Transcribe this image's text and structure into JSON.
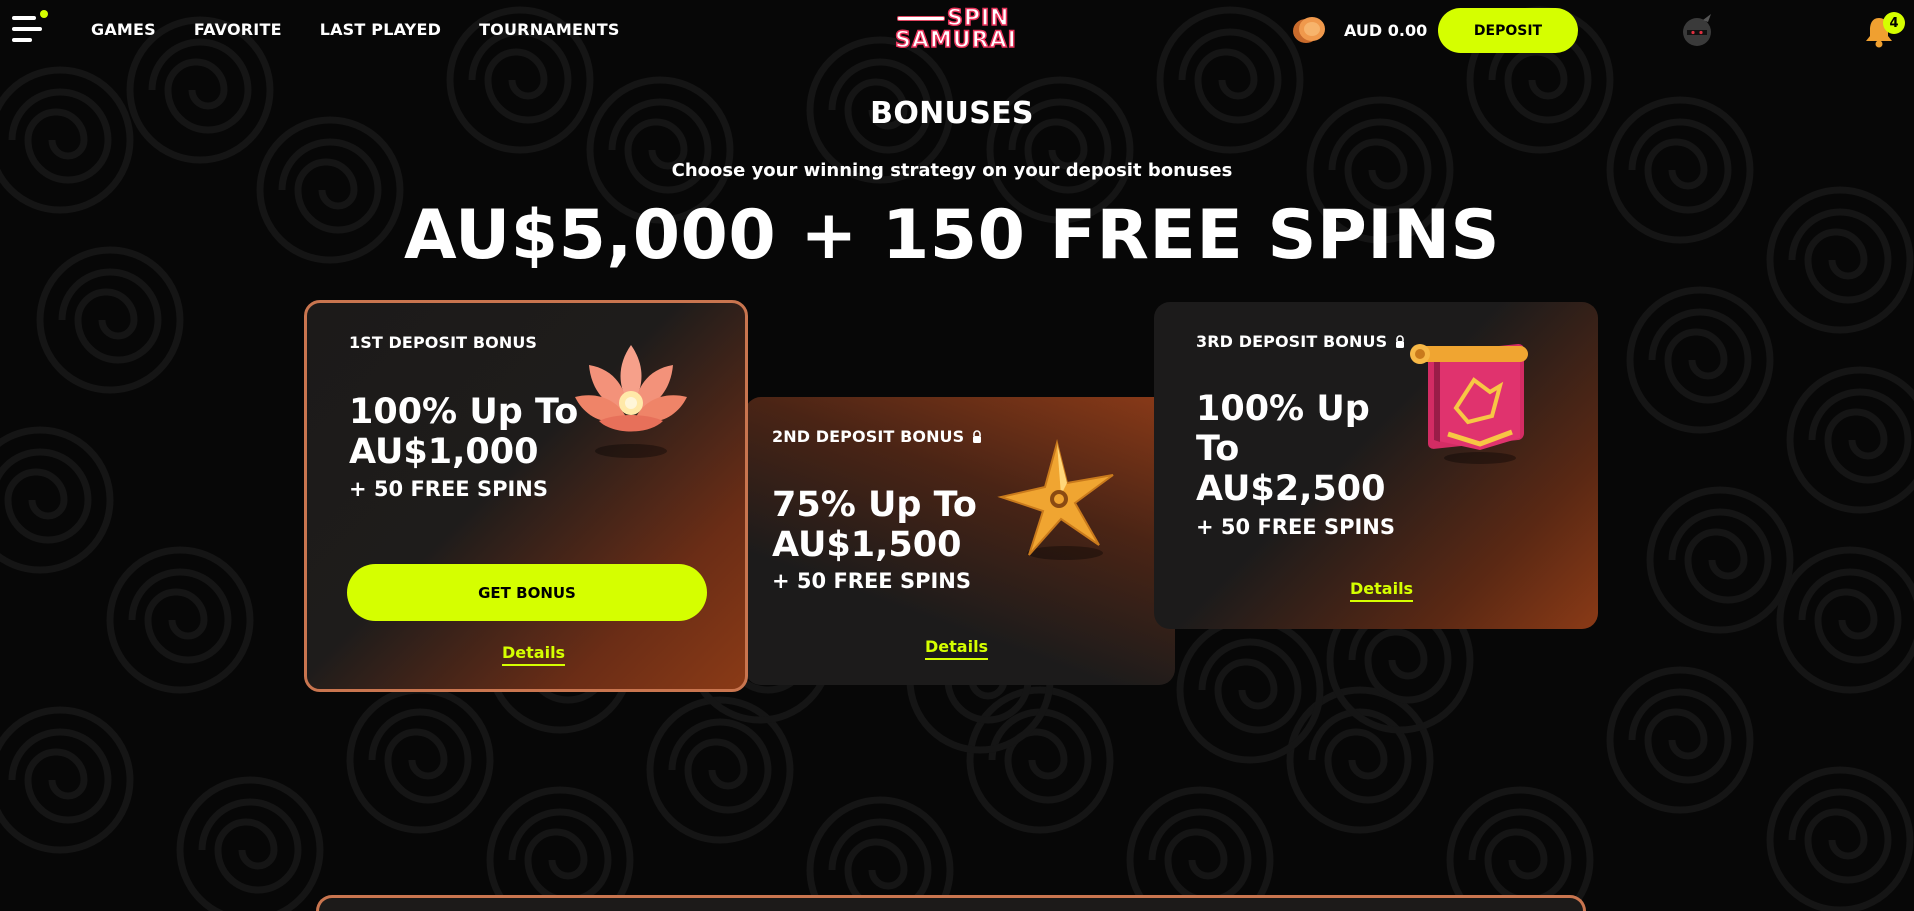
{
  "header": {
    "nav": [
      "GAMES",
      "FAVORITE",
      "LAST PLAYED",
      "TOURNAMENTS"
    ],
    "logo_top": "SPIN",
    "logo_bottom": "SAMURAI",
    "balance": "AUD 0.00",
    "deposit_label": "DEPOSIT",
    "notifications_count": "4",
    "accent_color": "#d5ff00"
  },
  "hero": {
    "title": "BONUSES",
    "subtitle": "Choose your winning strategy on your deposit bonuses",
    "headline": "AU$5,000 + 150 FREE SPINS"
  },
  "cards": [
    {
      "label": "1ST DEPOSIT BONUS",
      "offer_line1": "100% Up To",
      "offer_line2": "AU$1,000",
      "spins": "+ 50 FREE SPINS",
      "button": "GET BONUS",
      "details": "Details",
      "icon": "lotus-icon"
    },
    {
      "label": "2ND DEPOSIT BONUS",
      "offer_line1": "75% Up To",
      "offer_line2": "AU$1,500",
      "spins": "+ 50 FREE SPINS",
      "details": "Details",
      "icon": "shuriken-icon",
      "locked": true
    },
    {
      "label": "3RD DEPOSIT BONUS",
      "offer_line1": "100% Up",
      "offer_line2": "To",
      "offer_line3": "AU$2,500",
      "spins": "+ 50 FREE SPINS",
      "details": "Details",
      "icon": "banner-icon",
      "locked": true
    }
  ]
}
